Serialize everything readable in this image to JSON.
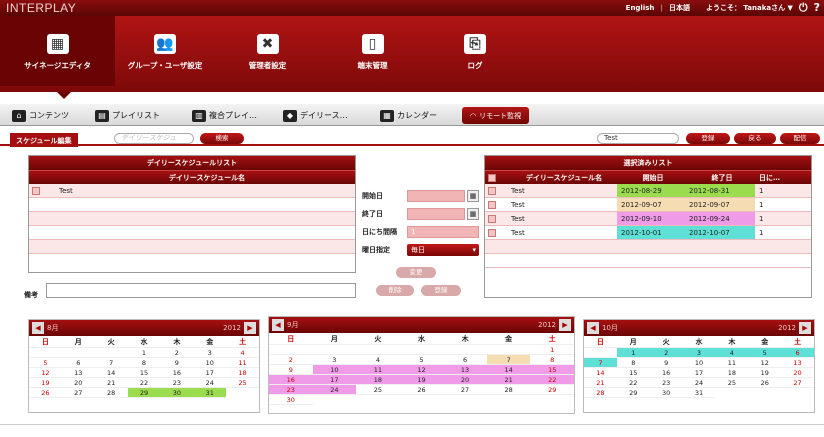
{
  "app": {
    "logo": "INTERPLAY"
  },
  "topbar": {
    "lang_en": "English",
    "sep": "|",
    "lang_ja": "日本語",
    "welcome": "ようこそ： Tanakaさん ▼",
    "power_icon": "⏻",
    "help_icon": "?"
  },
  "nav": [
    {
      "label": "サイネージエディタ",
      "icon": "editor-icon",
      "glyph": "▦"
    },
    {
      "label": "グループ・ユーザ設定",
      "icon": "group-icon",
      "glyph": "👥"
    },
    {
      "label": "管理者設定",
      "icon": "tools-icon",
      "glyph": "✖"
    },
    {
      "label": "端末管理",
      "icon": "device-icon",
      "glyph": "▯"
    },
    {
      "label": "ログ",
      "icon": "log-icon",
      "glyph": "⎘"
    }
  ],
  "subnav": [
    {
      "label": "コンテンツ",
      "glyph": "⌂"
    },
    {
      "label": "プレイリスト",
      "glyph": "▤"
    },
    {
      "label": "複合プレイ…",
      "glyph": "▥"
    },
    {
      "label": "デイリース…",
      "glyph": "◆"
    },
    {
      "label": "カレンダー",
      "glyph": "▦"
    },
    {
      "label": "リモート監視",
      "glyph": "◠"
    }
  ],
  "toolbar": {
    "tab": "スケジュール編集",
    "search_placeholder": "デイリースケジュ",
    "search_btn": "検索",
    "name_value": "Test",
    "register_btn": "登録",
    "back_btn": "戻る",
    "deliver_btn": "配信"
  },
  "left_list": {
    "title": "デイリースケジュールリスト",
    "col": "デイリースケジュール名",
    "rows": [
      "Test"
    ]
  },
  "middle": {
    "start_label": "開始日",
    "end_label": "終了日",
    "interval_label": "日にち間隔",
    "interval_value": "1",
    "weekday_label": "曜日指定",
    "weekday_value": "毎日",
    "change_btn": "変更",
    "delete_btn": "削除",
    "add_btn": "登録"
  },
  "right_list": {
    "title": "選択済みリスト",
    "cols": [
      "デイリースケジュール名",
      "開始日",
      "終了日",
      "日に…"
    ],
    "rows": [
      {
        "name": "Test",
        "start": "2012-08-29",
        "end": "2012-08-31",
        "n": "1",
        "color": "#9bdc4e"
      },
      {
        "name": "Test",
        "start": "2012-09-07",
        "end": "2012-09-07",
        "n": "1",
        "color": "#f6dcb3"
      },
      {
        "name": "Test",
        "start": "2012-09-10",
        "end": "2012-09-24",
        "n": "1",
        "color": "#ef9be8"
      },
      {
        "name": "Test",
        "start": "2012-10-01",
        "end": "2012-10-07",
        "n": "1",
        "color": "#5fe0d6"
      }
    ]
  },
  "remarks": {
    "label": "備考"
  },
  "weekdays": [
    "日",
    "月",
    "火",
    "水",
    "木",
    "金",
    "土"
  ],
  "calendars": [
    {
      "month": "8月",
      "year": "2012",
      "lead": 3,
      "days": 31,
      "hl": {
        "29": "#9bdc4e",
        "30": "#9bdc4e",
        "31": "#9bdc4e"
      }
    },
    {
      "month": "9月",
      "year": "2012",
      "lead": 6,
      "days": 30,
      "hl": {
        "7": "#f6dcb3",
        "10": "#ef9be8",
        "11": "#ef9be8",
        "12": "#ef9be8",
        "13": "#ef9be8",
        "14": "#ef9be8",
        "15": "#ef9be8",
        "16": "#ef9be8",
        "17": "#ef9be8",
        "18": "#ef9be8",
        "19": "#ef9be8",
        "20": "#ef9be8",
        "21": "#ef9be8",
        "22": "#ef9be8",
        "23": "#ef9be8",
        "24": "#ef9be8"
      }
    },
    {
      "month": "10月",
      "year": "2012",
      "lead": 1,
      "days": 31,
      "hl": {
        "1": "#5fe0d6",
        "2": "#5fe0d6",
        "3": "#5fe0d6",
        "4": "#5fe0d6",
        "5": "#5fe0d6",
        "6": "#5fe0d6",
        "7": "#5fe0d6"
      }
    }
  ]
}
